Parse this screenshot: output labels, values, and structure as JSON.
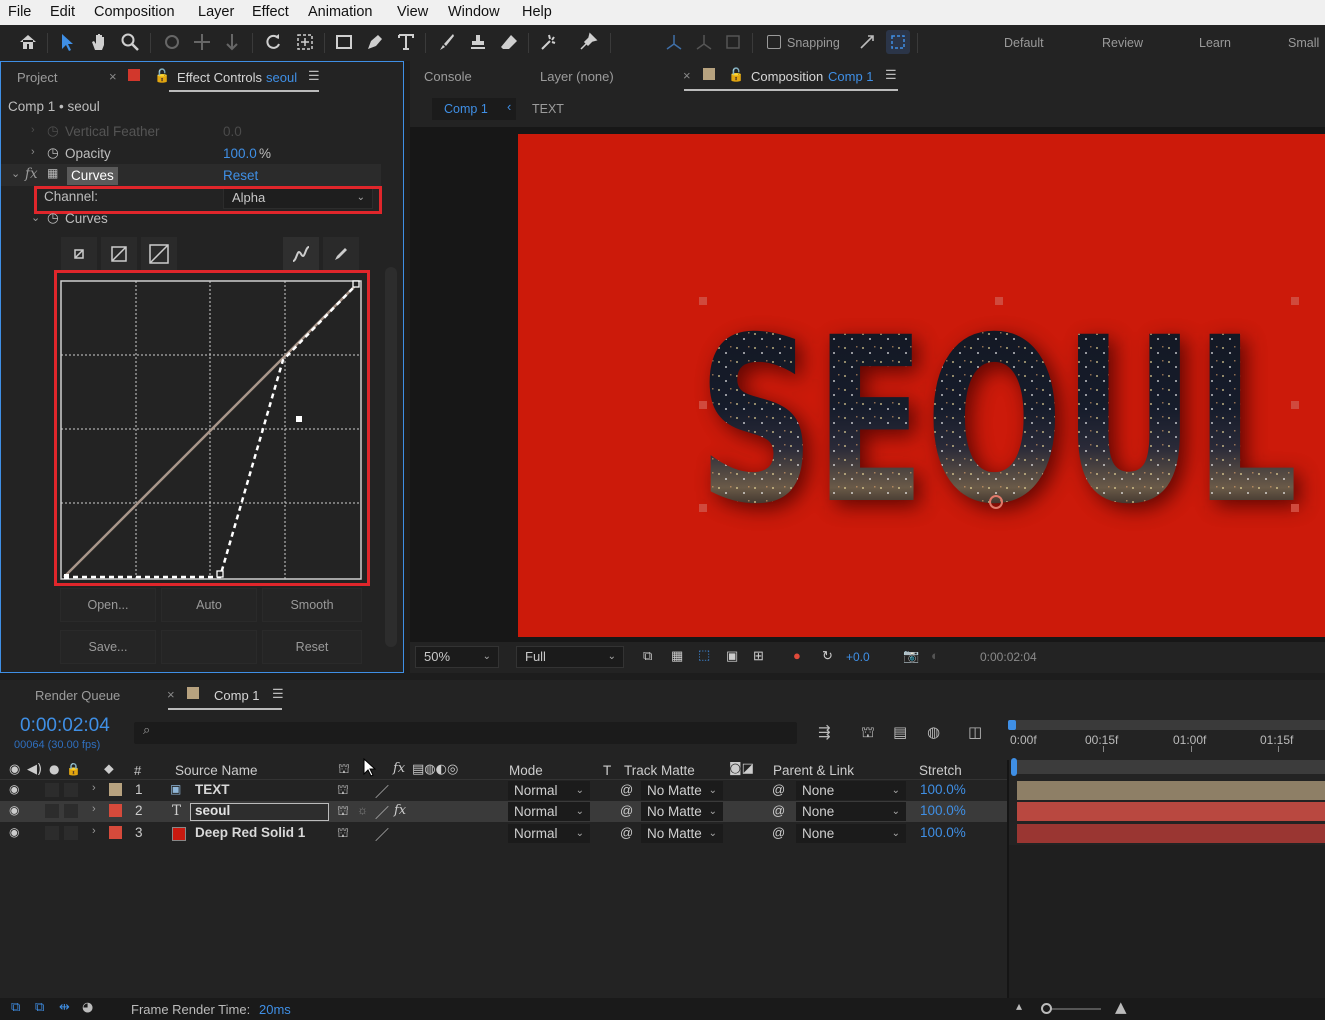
{
  "menu": [
    "File",
    "Edit",
    "Composition",
    "Layer",
    "Effect",
    "Animation",
    "View",
    "Window",
    "Help"
  ],
  "toolbar": {
    "snapping_label": "Snapping",
    "workspaces": [
      "Default",
      "Review",
      "Learn",
      "Small"
    ]
  },
  "effect_panel": {
    "tab_project": "Project",
    "tab_effect_controls": "Effect Controls",
    "tab_effect_layer": "seoul",
    "breadcrumb": "Comp 1 • seoul",
    "vertical_feather": {
      "label": "Vertical Feather",
      "value": "0.0"
    },
    "opacity": {
      "label": "Opacity",
      "value": "100.0",
      "unit": "%"
    },
    "fx_symbol": "fx",
    "curves_effect": {
      "label": "Curves",
      "reset": "Reset"
    },
    "channel": {
      "label": "Channel:",
      "value": "Alpha"
    },
    "curves_prop_label": "Curves",
    "buttons": {
      "open": "Open...",
      "auto": "Auto",
      "smooth": "Smooth",
      "save": "Save...",
      "reset": "Reset"
    }
  },
  "comp_panel": {
    "tab_console": "Console",
    "tab_layer": "Layer (none)",
    "tab_composition": "Composition",
    "tab_comp_name": "Comp 1",
    "nav_comp": "Comp 1",
    "nav_text": "TEXT",
    "viewer_text": "SEOUL",
    "zoom": "50%",
    "resolution": "Full",
    "exposure": "+0.0",
    "timecode": "0:00:02:04"
  },
  "timeline": {
    "tab_render_queue": "Render Queue",
    "tab_comp": "Comp 1",
    "current_time": "0:00:02:04",
    "frame_info": "00064 (30.00 fps)",
    "headers": {
      "num": "#",
      "source_name": "Source Name",
      "fx": "fx",
      "mode": "Mode",
      "t": "T",
      "track_matte": "Track Matte",
      "parent_link": "Parent & Link",
      "stretch": "Stretch"
    },
    "ruler": [
      "0:00f",
      "00:15f",
      "01:00f",
      "01:15f"
    ],
    "layers": [
      {
        "num": "1",
        "name": "TEXT",
        "mode": "Normal",
        "matte": "No Matte",
        "parent": "None",
        "stretch": "100.0%",
        "label_color": "#b7a27f"
      },
      {
        "num": "2",
        "type_glyph": "T",
        "name": "seoul",
        "mode": "Normal",
        "matte": "No Matte",
        "parent": "None",
        "stretch": "100.0%",
        "label_color": "#d64a3b"
      },
      {
        "num": "3",
        "name": "Deep Red Solid 1",
        "mode": "Normal",
        "matte": "No Matte",
        "parent": "None",
        "stretch": "100.0%",
        "label_color": "#d64a3b"
      }
    ],
    "footer": {
      "render_label": "Frame Render Time:",
      "render_value": "20ms"
    }
  },
  "colors": {
    "accent": "#3f8fe5",
    "highlight_red": "#e0262b",
    "comp_background": "#cc1a0a",
    "panel": "#232323"
  }
}
